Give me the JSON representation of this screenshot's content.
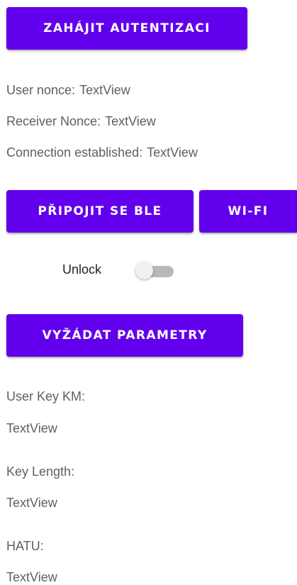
{
  "buttons": {
    "auth": "ZAHÁJIT AUTENTIZACI",
    "ble": "PŘIPOJIT SE BLE",
    "wifi": "WI-FI",
    "params": "VYŽÁDAT PARAMETRY"
  },
  "status": {
    "user_nonce_label": "User nonce:",
    "user_nonce_value": "TextView",
    "receiver_nonce_label": "Receiver Nonce:",
    "receiver_nonce_value": "TextView",
    "connection_label": "Connection established:",
    "connection_value": "TextView"
  },
  "unlock": {
    "label": "Unlock",
    "checked": false
  },
  "params": {
    "user_key_label": "User Key KM:",
    "user_key_value": "TextView",
    "key_length_label": "Key Length:",
    "key_length_value": "TextView",
    "hatu_label": "HATU:",
    "hatu_value": "TextView"
  },
  "colors": {
    "accent": "#6200ee",
    "text": "#5f5f5f",
    "switch_track_off": "#b8b8b8",
    "switch_thumb_off": "#f1f1f1"
  }
}
